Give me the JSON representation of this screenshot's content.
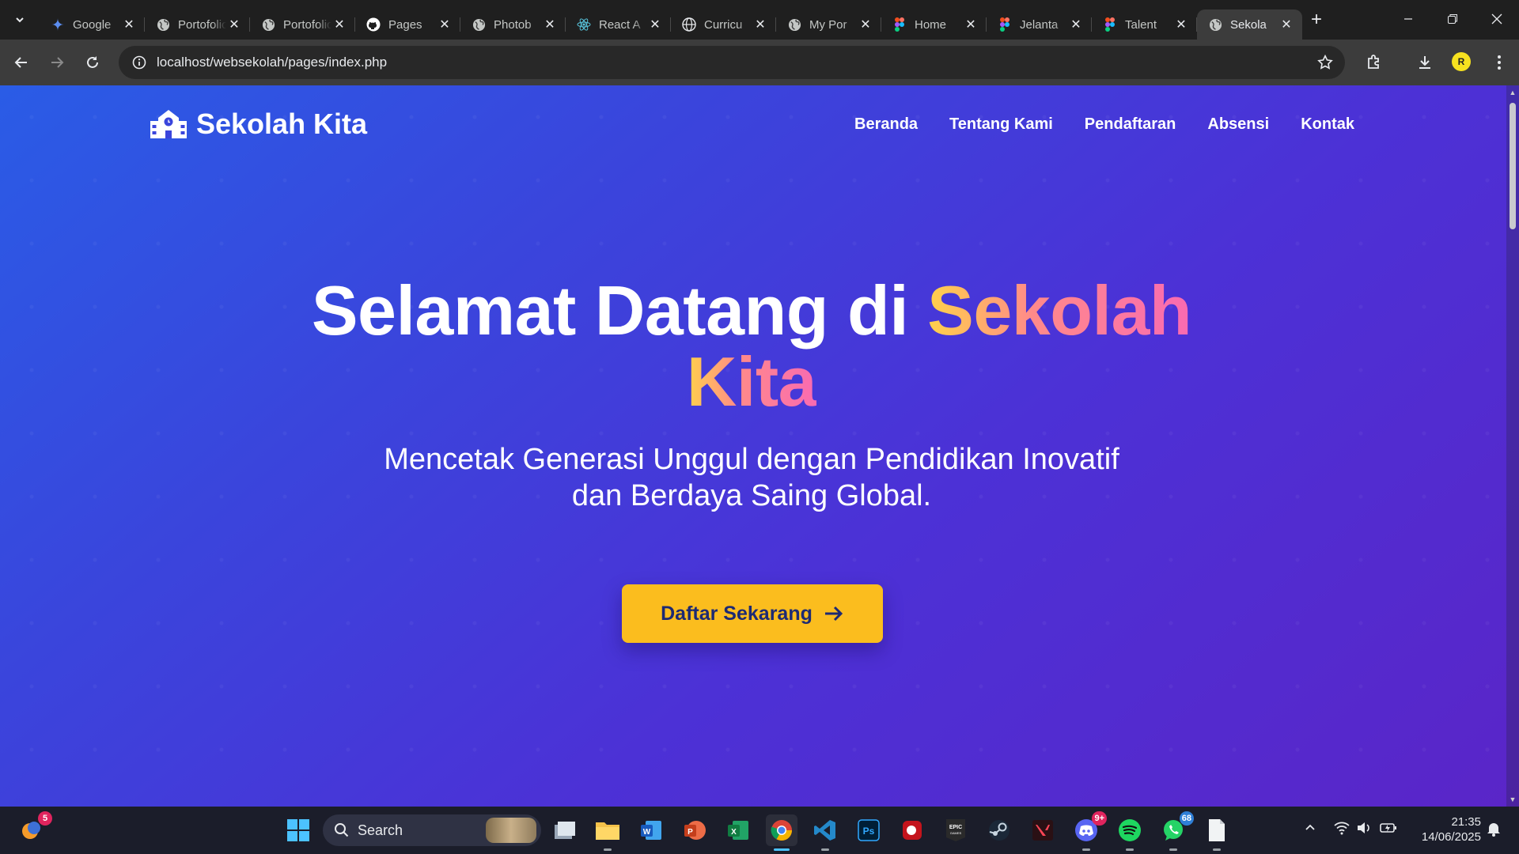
{
  "browser": {
    "tabs": [
      {
        "label": "Google",
        "icon": "gemini-icon"
      },
      {
        "label": "Portofolio",
        "icon": "globe-icon"
      },
      {
        "label": "Portofolio",
        "icon": "globe-icon"
      },
      {
        "label": "Pages",
        "icon": "github-icon"
      },
      {
        "label": "Photob",
        "icon": "globe-icon"
      },
      {
        "label": "React A",
        "icon": "react-icon"
      },
      {
        "label": "Curricu",
        "icon": "world-icon"
      },
      {
        "label": "My Por",
        "icon": "globe-icon"
      },
      {
        "label": "Home",
        "icon": "figma-icon"
      },
      {
        "label": "Jelanta",
        "icon": "figma-icon"
      },
      {
        "label": "Talent",
        "icon": "figma-icon"
      },
      {
        "label": "Sekola",
        "icon": "globe-icon"
      }
    ],
    "active_tab_index": 11,
    "url": "localhost/websekolah/pages/index.php",
    "profile_initial": "R"
  },
  "site": {
    "brand": "Sekolah Kita",
    "menu": [
      "Beranda",
      "Tentang Kami",
      "Pendaftaran",
      "Absensi",
      "Kontak"
    ],
    "hero": {
      "title_part1": "Selamat Datang di",
      "title_highlight_1": "Sekolah",
      "title_highlight_2": "Kita",
      "subtitle": "Mencetak Generasi Unggul dengan Pendidikan Inovatif dan Berdaya Saing Global.",
      "cta_label": "Daftar Sekarang"
    },
    "colors": {
      "accent": "#fbbd1e",
      "cta_text": "#1d2a73",
      "gradient_start": "#ffd24a",
      "gradient_end": "#f96ab2"
    }
  },
  "taskbar": {
    "search_label": "Search",
    "weather_badge": "5",
    "discord_badge": "9+",
    "whatsapp_badge": "68",
    "time": "21:35",
    "date": "14/06/2025"
  }
}
